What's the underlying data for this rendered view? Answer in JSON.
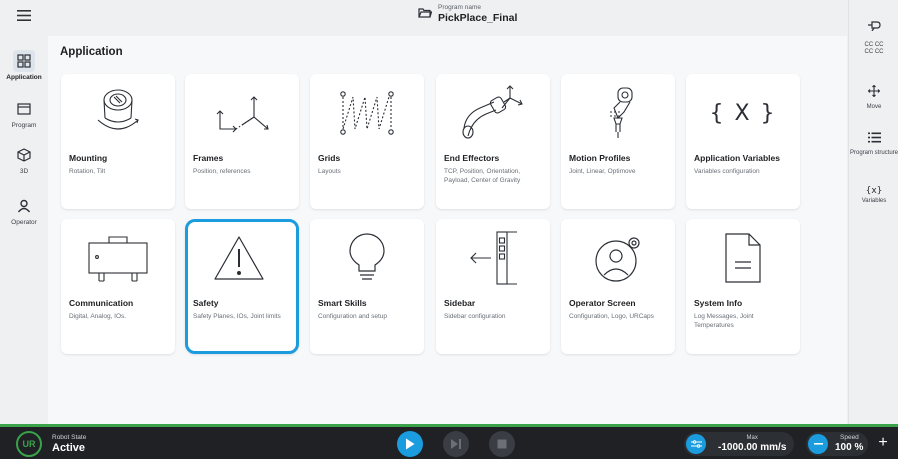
{
  "topbar": {
    "program_caption": "Program name",
    "program_name": "PickPlace_Final"
  },
  "leftnav": {
    "items": [
      {
        "label": "Application",
        "icon": "grid-icon"
      },
      {
        "label": "Program",
        "icon": "window-icon"
      },
      {
        "label": "3D",
        "icon": "cube-icon"
      },
      {
        "label": "Operator",
        "icon": "person-icon"
      }
    ]
  },
  "main": {
    "title": "Application",
    "cards": [
      {
        "title": "Mounting",
        "subtitle": "Rotation, Tilt",
        "icon": "mounting-icon"
      },
      {
        "title": "Frames",
        "subtitle": "Position, references",
        "icon": "frames-icon"
      },
      {
        "title": "Grids",
        "subtitle": "Layouts",
        "icon": "grids-icon"
      },
      {
        "title": "End Effectors",
        "subtitle": "TCP, Position, Orientation, Payload, Center of Gravity",
        "icon": "end-effector-icon"
      },
      {
        "title": "Motion Profiles",
        "subtitle": "Joint, Linear, Optimove",
        "icon": "motion-profile-icon"
      },
      {
        "title": "Application Variables",
        "subtitle": "Variables configuration",
        "icon": "variables-icon",
        "glyph": "{ X }"
      },
      {
        "title": "Communication",
        "subtitle": "Digital, Analog, IOs.",
        "icon": "io-box-icon"
      },
      {
        "title": "Safety",
        "subtitle": "Safety Planes, IOs, Joint limits",
        "icon": "warning-icon"
      },
      {
        "title": "Smart Skills",
        "subtitle": "Configuration and setup",
        "icon": "lightbulb-icon"
      },
      {
        "title": "Sidebar",
        "subtitle": "Sidebar configuration",
        "icon": "sidebar-icon"
      },
      {
        "title": "Operator Screen",
        "subtitle": "Configuration, Logo, URCaps",
        "icon": "operator-screen-icon"
      },
      {
        "title": "System Info",
        "subtitle": "Log Messages, Joint Temperatures",
        "icon": "document-icon"
      }
    ]
  },
  "rightnav": {
    "ccc_lines": [
      "CC CC",
      "CC CC"
    ],
    "items": [
      {
        "label": "Move",
        "icon": "move-icon"
      },
      {
        "label": "Program structure",
        "icon": "list-icon"
      },
      {
        "label": "Variables",
        "icon": "variables-small-icon",
        "glyph": "{x}"
      }
    ]
  },
  "bottombar": {
    "robot_state_caption": "Robot State",
    "robot_state": "Active",
    "logo_text": "UR",
    "max_caption": "Max",
    "max_value": "-1000.00 mm/s",
    "speed_caption": "Speed",
    "speed_value": "100 %",
    "plus": "+"
  },
  "colors": {
    "accent": "#1a9cdf",
    "state_active": "#3aa34a",
    "bottom_bg": "#1f2125"
  }
}
